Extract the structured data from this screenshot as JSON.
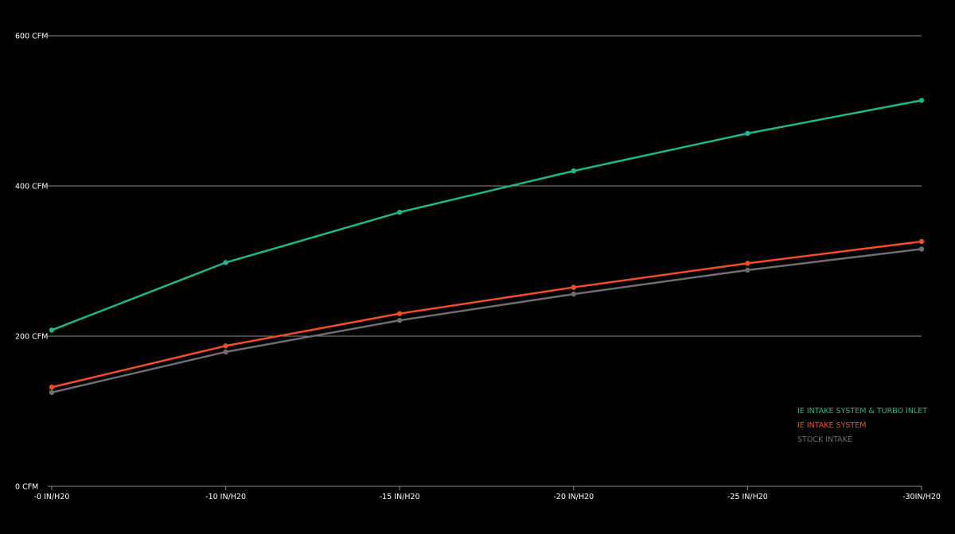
{
  "chart_data": {
    "type": "line",
    "title": "",
    "xlabel": "",
    "ylabel": "",
    "categories": [
      "-0 IN/H20",
      "-10 IN/H20",
      "-15 IN/H20",
      "-20 IN/H20",
      "-25 IN/H20",
      "-30IN/H20"
    ],
    "y_ticks": [
      {
        "value": 0,
        "label": "0 CFM"
      },
      {
        "value": 200,
        "label": "200 CFM"
      },
      {
        "value": 400,
        "label": "400 CFM"
      },
      {
        "value": 600,
        "label": "600 CFM"
      }
    ],
    "ylim": [
      0,
      600
    ],
    "grid": true,
    "legend_position": "bottom-right",
    "series": [
      {
        "name": "IE INTAKE SYSTEM & TURBO INLET",
        "color": "#1fb58f",
        "values": [
          208,
          298,
          365,
          420,
          470,
          514
        ]
      },
      {
        "name": "IE INTAKE SYSTEM",
        "color": "#f04e23",
        "values": [
          132,
          187,
          230,
          265,
          297,
          326
        ]
      },
      {
        "name": "STOCK INTAKE",
        "color": "#6e6e6e",
        "values": [
          125,
          179,
          221,
          256,
          288,
          316
        ]
      }
    ]
  }
}
